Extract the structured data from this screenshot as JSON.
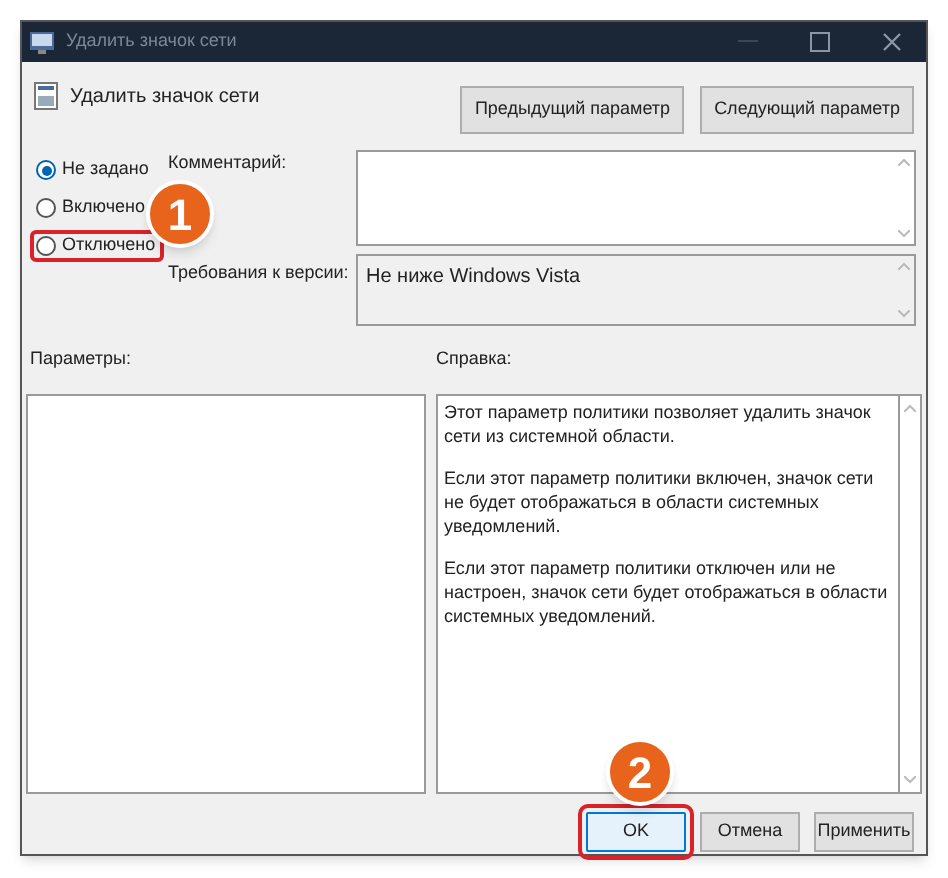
{
  "window": {
    "title": "Удалить значок сети"
  },
  "header": {
    "title": "Удалить значок сети",
    "buttons": [
      "Предыдущий параметр",
      "Следующий параметр"
    ]
  },
  "state_options": [
    {
      "label": "Не задано",
      "selected": true,
      "highlighted": false
    },
    {
      "label": "Включено",
      "selected": false,
      "highlighted": false
    },
    {
      "label": "Отключено",
      "selected": false,
      "highlighted": true
    }
  ],
  "comment": {
    "label": "Комментарий:"
  },
  "requirements": {
    "label": "Требования к версии:",
    "value": "Не ниже Windows Vista"
  },
  "options": {
    "label": "Параметры:"
  },
  "help": {
    "label": "Справка:",
    "paragraphs": [
      "Этот параметр политики позволяет удалить значок сети из системной области.",
      "Если этот параметр политики включен, значок сети не будет отображаться в области системных уведомлений.",
      "Если этот параметр политики отключен или не настроен, значок сети будет отображаться в области системных уведомлений."
    ]
  },
  "buttons": [
    {
      "label": "OK",
      "highlighted": true
    },
    {
      "label": "Отмена",
      "highlighted": false
    },
    {
      "label": "Применить",
      "highlighted": false
    }
  ],
  "step_badges": [
    "1",
    "2"
  ]
}
